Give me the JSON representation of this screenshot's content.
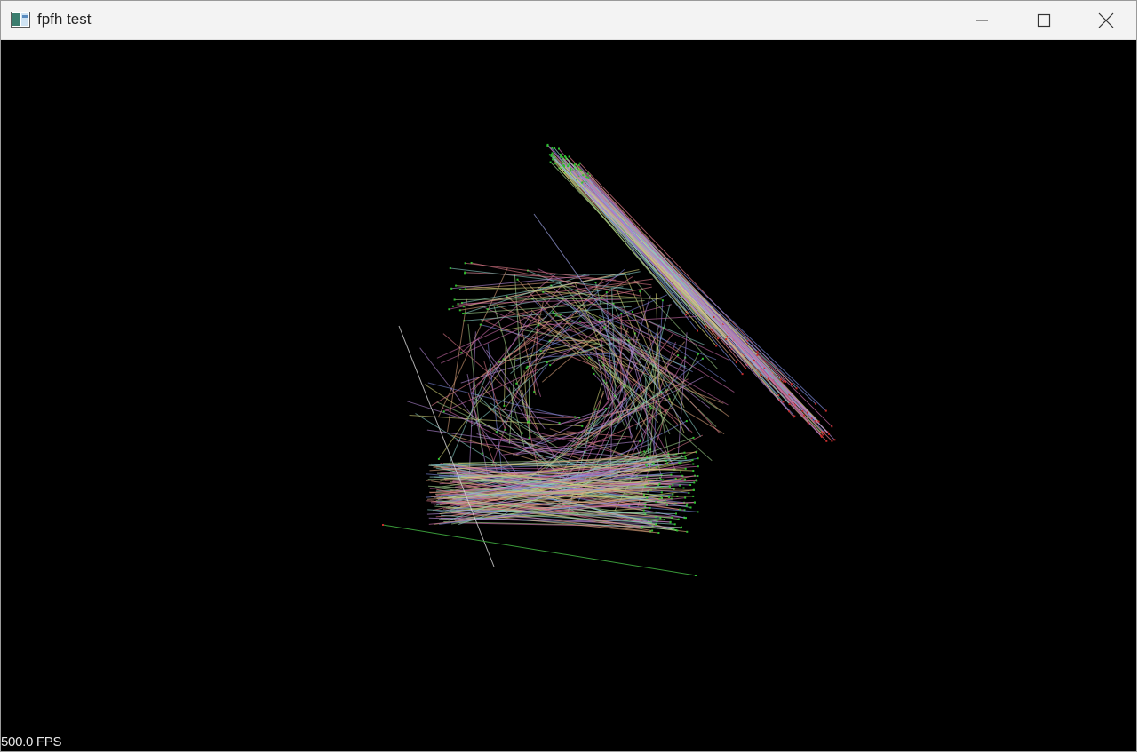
{
  "window": {
    "title": "fpfh test"
  },
  "titlebar_controls": {
    "minimize_icon": "minimize-icon",
    "maximize_icon": "maximize-icon",
    "close_icon": "close-icon"
  },
  "viewport": {
    "background": "#000000",
    "fps_text": "500.0 FPS",
    "content": "correspondence-lines"
  },
  "colors": {
    "titlebar": "#f3f3f3",
    "point_green": "#2fbf2f",
    "point_red": "#c42a2a",
    "line_palette": [
      "#c96aa8",
      "#7a86d6",
      "#9fd08a",
      "#d8a07a",
      "#8ad0c8",
      "#b58ad8",
      "#d4d47a",
      "#e07a8a"
    ]
  }
}
